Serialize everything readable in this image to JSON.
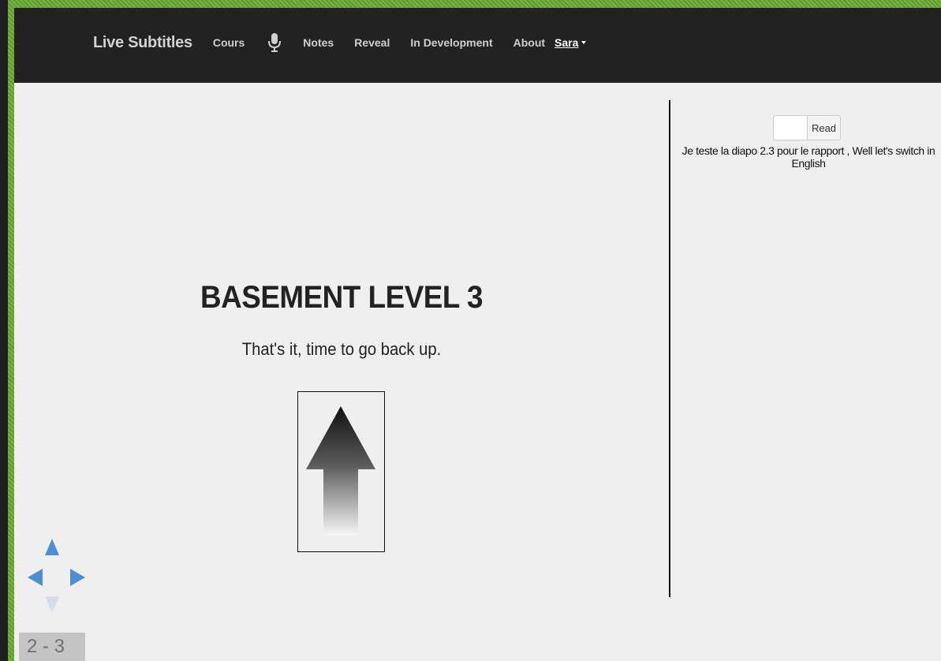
{
  "navbar": {
    "brand": "Live Subtitles",
    "items": [
      {
        "label": "Cours"
      },
      {
        "label": "Notes"
      },
      {
        "label": "Reveal"
      },
      {
        "label": "In Development"
      },
      {
        "label": "About"
      }
    ],
    "mic_icon": "microphone-icon",
    "user": "Sara"
  },
  "slide": {
    "title": "BASEMENT LEVEL 3",
    "subtitle": "That's it, time to go back up.",
    "image_icon": "up-arrow-icon",
    "number": "2 - 3"
  },
  "controls": {
    "up_icon": "arrow-up-icon",
    "left_icon": "arrow-left-icon",
    "right_icon": "arrow-right-icon",
    "down_icon": "arrow-down-icon"
  },
  "subtitles": {
    "input_value": "",
    "read_label": "Read",
    "text": "Je teste la diapo 2.3 pour le rapport , Well let's switch in English"
  },
  "colors": {
    "navbar_bg": "#222222",
    "frame_green": "#6aa43a",
    "content_bg": "#efefef",
    "control_blue": "#4a8fd4",
    "control_disabled": "#d3dde8"
  }
}
